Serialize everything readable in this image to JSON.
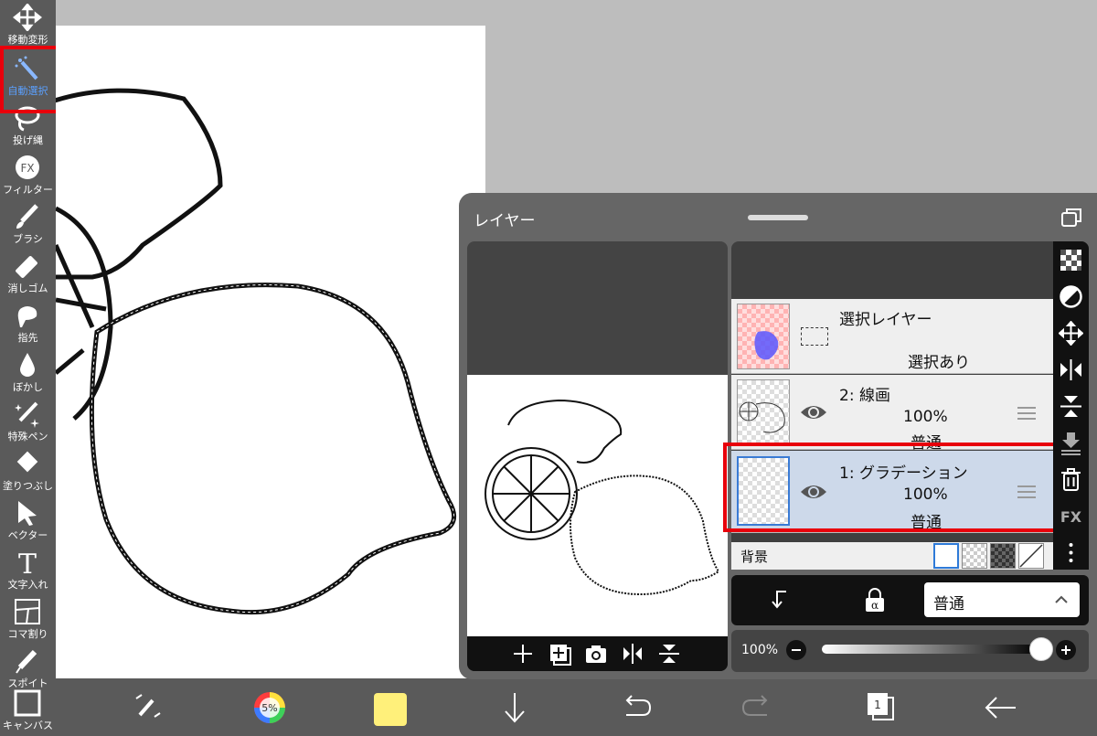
{
  "toolbar": {
    "items": [
      {
        "label": "移動変形",
        "icon": "move-icon"
      },
      {
        "label": "自動選択",
        "icon": "magic-wand-icon",
        "active": true
      },
      {
        "label": "投げ縄",
        "icon": "lasso-icon"
      },
      {
        "label": "フィルター",
        "icon": "fx-icon"
      },
      {
        "label": "ブラシ",
        "icon": "brush-icon"
      },
      {
        "label": "消しゴム",
        "icon": "eraser-icon"
      },
      {
        "label": "指先",
        "icon": "finger-icon"
      },
      {
        "label": "ぼかし",
        "icon": "blur-drop-icon"
      },
      {
        "label": "特殊ペン",
        "icon": "special-pen-icon"
      },
      {
        "label": "塗りつぶし",
        "icon": "fill-icon"
      },
      {
        "label": "ベクター",
        "icon": "vector-arrow-icon"
      },
      {
        "label": "文字入れ",
        "icon": "text-icon"
      },
      {
        "label": "コマ割り",
        "icon": "frame-divider-icon"
      },
      {
        "label": "スポイト",
        "icon": "eyedropper-icon"
      },
      {
        "label": "キャンバス",
        "icon": "canvas-icon"
      }
    ]
  },
  "bottombar": {
    "brush_size_label": "5%",
    "current_color": "#fff07a",
    "page_count": "1",
    "icons": [
      "swap-tool-icon",
      "color-wheel-icon",
      "color-swatch-icon",
      "down-arrow-icon",
      "undo-icon",
      "redo-icon",
      "pages-icon",
      "back-arrow-icon"
    ]
  },
  "panel": {
    "title": "レイヤー",
    "layers": [
      {
        "name": "選択レイヤー",
        "status": "選択あり",
        "type": "selection"
      },
      {
        "name": "2: 線画",
        "opacity": "100%",
        "blend": "普通",
        "visible": true
      },
      {
        "name": "1: グラデーション",
        "opacity": "100%",
        "blend": "普通",
        "visible": true,
        "selected": true
      }
    ],
    "background_label": "背景",
    "blend_mode": "普通",
    "opacity_label": "100%",
    "opacity_value": 1.0,
    "sidebar_label_fx": "FX"
  },
  "colors": {
    "toolbar_bg": "#5a5a5a",
    "highlight_red": "#e8000b",
    "active_tool_text": "#5aa0ff",
    "selected_layer_bg": "#cdd9ea"
  }
}
